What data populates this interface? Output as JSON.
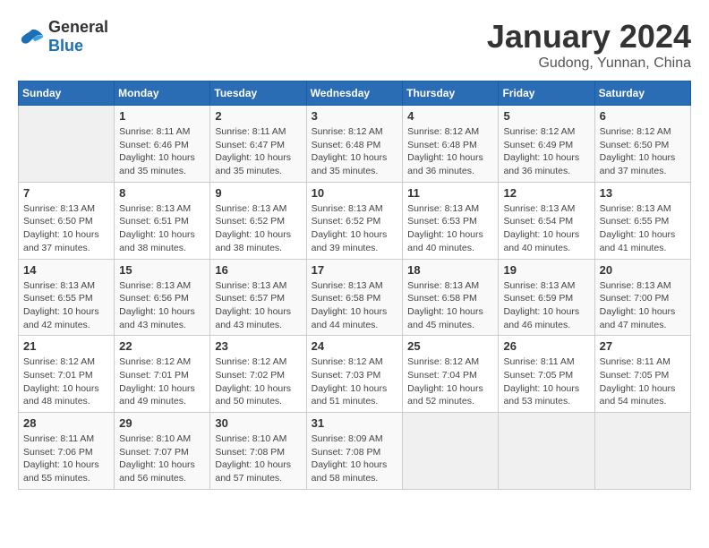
{
  "header": {
    "logo_general": "General",
    "logo_blue": "Blue",
    "month_year": "January 2024",
    "location": "Gudong, Yunnan, China"
  },
  "calendar": {
    "days_of_week": [
      "Sunday",
      "Monday",
      "Tuesday",
      "Wednesday",
      "Thursday",
      "Friday",
      "Saturday"
    ],
    "weeks": [
      [
        {
          "day": "",
          "empty": true
        },
        {
          "day": "1",
          "sunrise": "Sunrise: 8:11 AM",
          "sunset": "Sunset: 6:46 PM",
          "daylight": "Daylight: 10 hours and 35 minutes."
        },
        {
          "day": "2",
          "sunrise": "Sunrise: 8:11 AM",
          "sunset": "Sunset: 6:47 PM",
          "daylight": "Daylight: 10 hours and 35 minutes."
        },
        {
          "day": "3",
          "sunrise": "Sunrise: 8:12 AM",
          "sunset": "Sunset: 6:48 PM",
          "daylight": "Daylight: 10 hours and 35 minutes."
        },
        {
          "day": "4",
          "sunrise": "Sunrise: 8:12 AM",
          "sunset": "Sunset: 6:48 PM",
          "daylight": "Daylight: 10 hours and 36 minutes."
        },
        {
          "day": "5",
          "sunrise": "Sunrise: 8:12 AM",
          "sunset": "Sunset: 6:49 PM",
          "daylight": "Daylight: 10 hours and 36 minutes."
        },
        {
          "day": "6",
          "sunrise": "Sunrise: 8:12 AM",
          "sunset": "Sunset: 6:50 PM",
          "daylight": "Daylight: 10 hours and 37 minutes."
        }
      ],
      [
        {
          "day": "7",
          "sunrise": "Sunrise: 8:13 AM",
          "sunset": "Sunset: 6:50 PM",
          "daylight": "Daylight: 10 hours and 37 minutes."
        },
        {
          "day": "8",
          "sunrise": "Sunrise: 8:13 AM",
          "sunset": "Sunset: 6:51 PM",
          "daylight": "Daylight: 10 hours and 38 minutes."
        },
        {
          "day": "9",
          "sunrise": "Sunrise: 8:13 AM",
          "sunset": "Sunset: 6:52 PM",
          "daylight": "Daylight: 10 hours and 38 minutes."
        },
        {
          "day": "10",
          "sunrise": "Sunrise: 8:13 AM",
          "sunset": "Sunset: 6:52 PM",
          "daylight": "Daylight: 10 hours and 39 minutes."
        },
        {
          "day": "11",
          "sunrise": "Sunrise: 8:13 AM",
          "sunset": "Sunset: 6:53 PM",
          "daylight": "Daylight: 10 hours and 40 minutes."
        },
        {
          "day": "12",
          "sunrise": "Sunrise: 8:13 AM",
          "sunset": "Sunset: 6:54 PM",
          "daylight": "Daylight: 10 hours and 40 minutes."
        },
        {
          "day": "13",
          "sunrise": "Sunrise: 8:13 AM",
          "sunset": "Sunset: 6:55 PM",
          "daylight": "Daylight: 10 hours and 41 minutes."
        }
      ],
      [
        {
          "day": "14",
          "sunrise": "Sunrise: 8:13 AM",
          "sunset": "Sunset: 6:55 PM",
          "daylight": "Daylight: 10 hours and 42 minutes."
        },
        {
          "day": "15",
          "sunrise": "Sunrise: 8:13 AM",
          "sunset": "Sunset: 6:56 PM",
          "daylight": "Daylight: 10 hours and 43 minutes."
        },
        {
          "day": "16",
          "sunrise": "Sunrise: 8:13 AM",
          "sunset": "Sunset: 6:57 PM",
          "daylight": "Daylight: 10 hours and 43 minutes."
        },
        {
          "day": "17",
          "sunrise": "Sunrise: 8:13 AM",
          "sunset": "Sunset: 6:58 PM",
          "daylight": "Daylight: 10 hours and 44 minutes."
        },
        {
          "day": "18",
          "sunrise": "Sunrise: 8:13 AM",
          "sunset": "Sunset: 6:58 PM",
          "daylight": "Daylight: 10 hours and 45 minutes."
        },
        {
          "day": "19",
          "sunrise": "Sunrise: 8:13 AM",
          "sunset": "Sunset: 6:59 PM",
          "daylight": "Daylight: 10 hours and 46 minutes."
        },
        {
          "day": "20",
          "sunrise": "Sunrise: 8:13 AM",
          "sunset": "Sunset: 7:00 PM",
          "daylight": "Daylight: 10 hours and 47 minutes."
        }
      ],
      [
        {
          "day": "21",
          "sunrise": "Sunrise: 8:12 AM",
          "sunset": "Sunset: 7:01 PM",
          "daylight": "Daylight: 10 hours and 48 minutes."
        },
        {
          "day": "22",
          "sunrise": "Sunrise: 8:12 AM",
          "sunset": "Sunset: 7:01 PM",
          "daylight": "Daylight: 10 hours and 49 minutes."
        },
        {
          "day": "23",
          "sunrise": "Sunrise: 8:12 AM",
          "sunset": "Sunset: 7:02 PM",
          "daylight": "Daylight: 10 hours and 50 minutes."
        },
        {
          "day": "24",
          "sunrise": "Sunrise: 8:12 AM",
          "sunset": "Sunset: 7:03 PM",
          "daylight": "Daylight: 10 hours and 51 minutes."
        },
        {
          "day": "25",
          "sunrise": "Sunrise: 8:12 AM",
          "sunset": "Sunset: 7:04 PM",
          "daylight": "Daylight: 10 hours and 52 minutes."
        },
        {
          "day": "26",
          "sunrise": "Sunrise: 8:11 AM",
          "sunset": "Sunset: 7:05 PM",
          "daylight": "Daylight: 10 hours and 53 minutes."
        },
        {
          "day": "27",
          "sunrise": "Sunrise: 8:11 AM",
          "sunset": "Sunset: 7:05 PM",
          "daylight": "Daylight: 10 hours and 54 minutes."
        }
      ],
      [
        {
          "day": "28",
          "sunrise": "Sunrise: 8:11 AM",
          "sunset": "Sunset: 7:06 PM",
          "daylight": "Daylight: 10 hours and 55 minutes."
        },
        {
          "day": "29",
          "sunrise": "Sunrise: 8:10 AM",
          "sunset": "Sunset: 7:07 PM",
          "daylight": "Daylight: 10 hours and 56 minutes."
        },
        {
          "day": "30",
          "sunrise": "Sunrise: 8:10 AM",
          "sunset": "Sunset: 7:08 PM",
          "daylight": "Daylight: 10 hours and 57 minutes."
        },
        {
          "day": "31",
          "sunrise": "Sunrise: 8:09 AM",
          "sunset": "Sunset: 7:08 PM",
          "daylight": "Daylight: 10 hours and 58 minutes."
        },
        {
          "day": "",
          "empty": true
        },
        {
          "day": "",
          "empty": true
        },
        {
          "day": "",
          "empty": true
        }
      ]
    ]
  }
}
